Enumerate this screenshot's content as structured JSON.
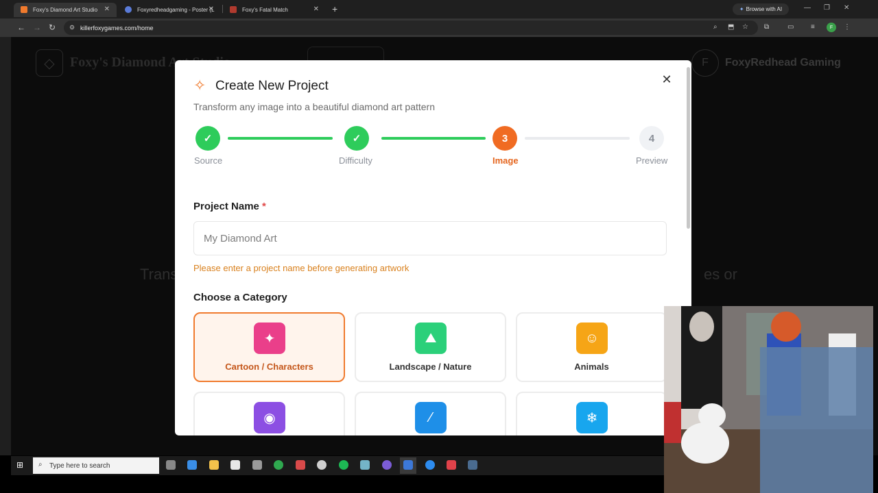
{
  "browser": {
    "tabs": [
      {
        "title": "Foxy's Diamond Art Studio",
        "active": true,
        "favicon_color": "#f07a2d"
      },
      {
        "title": "Foxyredheadgaming - Poster (L",
        "active": false,
        "favicon_color": "#5a7bd8"
      },
      {
        "title": "Foxy's Fatal Match",
        "active": false,
        "favicon_color": "#b03a2e"
      }
    ],
    "new_tab": "+",
    "browse_ai_label": "Browse with AI",
    "url": "killerfoxygames.com/home",
    "profile_initial": "F"
  },
  "background_page": {
    "site_title": "Foxy's Diamond Art Studio",
    "user_initial": "F",
    "user_name": "FoxyRedhead Gaming",
    "hero_left": "Trans",
    "hero_right": "es or"
  },
  "modal": {
    "title": "Create New Project",
    "subtitle": "Transform any image into a beautiful diamond art pattern",
    "close_icon": "close-icon",
    "steps": [
      {
        "number": "1",
        "label": "Source",
        "state": "done"
      },
      {
        "number": "2",
        "label": "Difficulty",
        "state": "done"
      },
      {
        "number": "3",
        "label": "Image",
        "state": "current"
      },
      {
        "number": "4",
        "label": "Preview",
        "state": "todo"
      }
    ],
    "project_name": {
      "label": "Project Name",
      "required_mark": "*",
      "placeholder": "My Diamond Art",
      "value": "",
      "warning": "Please enter a project name before generating artwork"
    },
    "category_heading": "Choose a Category",
    "categories": [
      {
        "label": "Cartoon / Characters",
        "icon": "sparkle-icon",
        "color": "#ea3f8a",
        "selected": true
      },
      {
        "label": "Landscape / Nature",
        "icon": "mountain-icon",
        "color": "#2bd07a",
        "selected": false
      },
      {
        "label": "Animals",
        "icon": "cat-icon",
        "color": "#f6a516",
        "selected": false
      },
      {
        "label": "",
        "icon": "palette-icon",
        "color": "#8c4fe3",
        "selected": false
      },
      {
        "label": "",
        "icon": "magic-wand-icon",
        "color": "#1e8fe8",
        "selected": false
      },
      {
        "label": "",
        "icon": "snowflake-icon",
        "color": "#18a6ee",
        "selected": false
      }
    ],
    "accent_color": "#f07a2d",
    "done_color": "#2ecc5b"
  },
  "taskbar": {
    "search_placeholder": "Type here to search"
  }
}
